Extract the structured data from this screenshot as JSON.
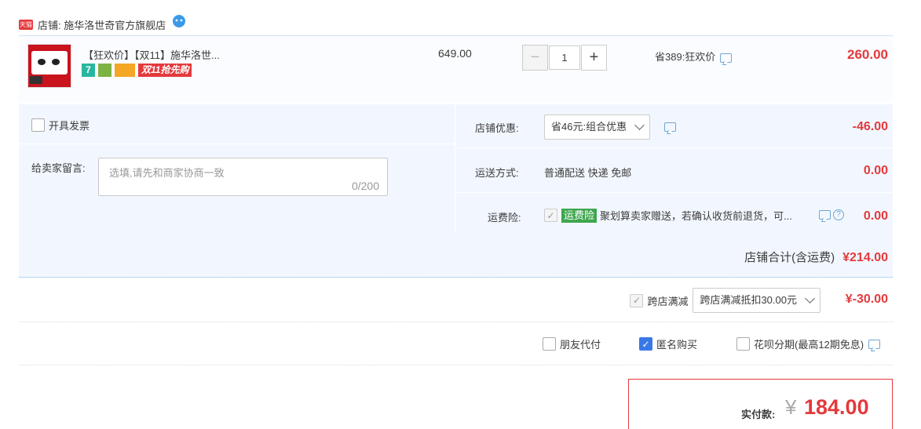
{
  "shop": {
    "tmall_badge": "天猫",
    "name": "店铺: 施华洛世奇官方旗舰店"
  },
  "item": {
    "title": "【狂欢价】【双11】施华洛世...",
    "badge_seven": "7",
    "badge_double11": "双11抢先购",
    "unit_price": "649.00",
    "quantity": "1",
    "minus": "−",
    "plus": "+",
    "discount": "省389:狂欢价",
    "subtotal": "260.00"
  },
  "invoice": {
    "label": "开具发票"
  },
  "message": {
    "label": "给卖家留言:",
    "placeholder": "选填,请先和商家协商一致",
    "counter": "0/200"
  },
  "shop_discount": {
    "label": "店铺优惠:",
    "selected": "省46元:组合优惠",
    "amount": "-46.00"
  },
  "shipping": {
    "label": "运送方式:",
    "value": "普通配送 快递 免邮",
    "amount": "0.00"
  },
  "insurance": {
    "label": "运费险:",
    "tag": "运费险",
    "text": "聚划算卖家赠送，若确认收货前退货，可...",
    "help": "?",
    "amount": "0.00"
  },
  "shop_total": {
    "label": "店铺合计(含运费)",
    "amount": "¥214.00"
  },
  "cross_shop": {
    "label": "跨店满减",
    "selected": "跨店满减抵扣30.00元",
    "amount": "¥-30.00"
  },
  "options": [
    {
      "label": "朋友代付",
      "checked": false
    },
    {
      "label": "匿名购买",
      "checked": true
    },
    {
      "label": "花呗分期(最高12期免息)",
      "checked": false
    }
  ],
  "payment": {
    "label": "实付款:",
    "currency": "¥",
    "amount": "184.00"
  },
  "colors": {
    "accent_red": "#e4393c",
    "light_blue": "#f2f7ff",
    "check_blue": "#3b78e7",
    "green_tag": "#3fa64f"
  }
}
